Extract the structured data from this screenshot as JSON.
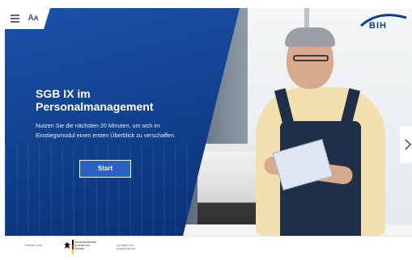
{
  "header": {
    "menu_icon": "hamburger-menu-icon",
    "font_size_label": "Aᴀ"
  },
  "logo": {
    "text": "BIH"
  },
  "hero": {
    "title": "SGB IX im Personalmanagement",
    "description": "Nutzen Sie die nächsten 20 Minuten, um sich im Einstiegsmodul einen ersten Überblick zu verschaffen.",
    "start_label": "Start"
  },
  "navigation": {
    "next_icon": "chevron-right-icon"
  },
  "footer": {
    "note_left": "Gefördert durch:",
    "ministry": "Bundesministerium für Arbeit und Soziales",
    "note_right": "aus Mitteln des Ausgleichsfonds"
  },
  "colors": {
    "panel_blue": "#0c3f95",
    "logo_blue": "#0d3c88",
    "button_blue": "#2b61c0"
  }
}
